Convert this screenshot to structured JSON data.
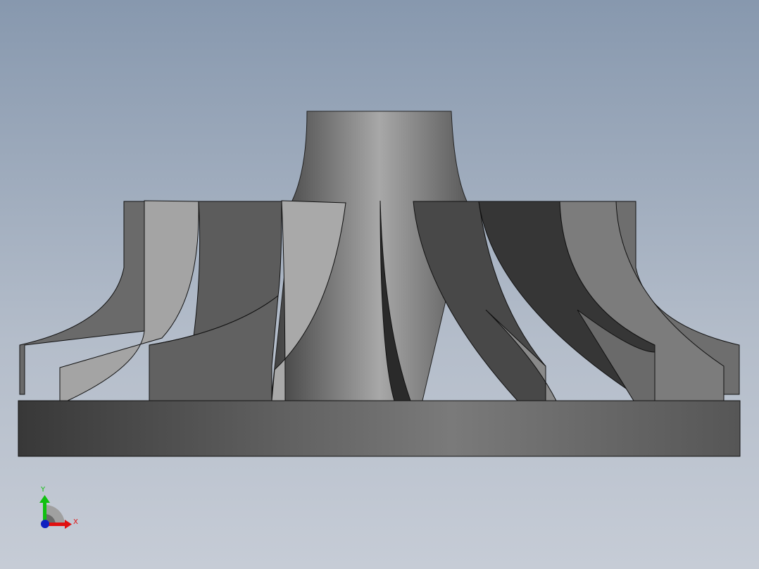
{
  "viewport": {
    "model": "impeller",
    "colors": {
      "background_top": "#8798ae",
      "background_bottom": "#c6ccd6",
      "x_axis": "#e01010",
      "y_axis": "#10c010",
      "z_axis": "#1020c0"
    }
  },
  "triad": {
    "x_label": "X",
    "y_label": "Y"
  }
}
